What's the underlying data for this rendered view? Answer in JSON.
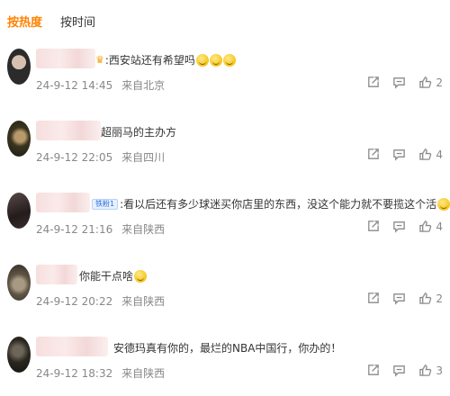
{
  "sort": {
    "hot": "按热度",
    "time": "按时间"
  },
  "comments": [
    {
      "text": ":西安站还有希望吗",
      "date": "24-9-12 14:45",
      "location": "来自北京",
      "likes": "2"
    },
    {
      "text": "超丽马的主办方",
      "date": "24-9-12 22:05",
      "location": "来自四川",
      "likes": "4"
    },
    {
      "text": ":看以后还有多少球迷买你店里的东西，没这个能力就不要揽这个活",
      "vip_label": "铁粉1",
      "date": "24-9-12 21:16",
      "location": "来自陕西",
      "likes": "4"
    },
    {
      "text": "你能干点啥",
      "date": "24-9-12 20:22",
      "location": "来自陕西",
      "likes": "2"
    },
    {
      "text": "安德玛真有你的，最烂的NBA中国行，你办的！",
      "date": "24-9-12 18:32",
      "location": "来自陕西",
      "likes": "3"
    }
  ],
  "icons": {
    "share": "share-icon",
    "reply": "comment-icon",
    "like": "thumbs-up-icon"
  }
}
